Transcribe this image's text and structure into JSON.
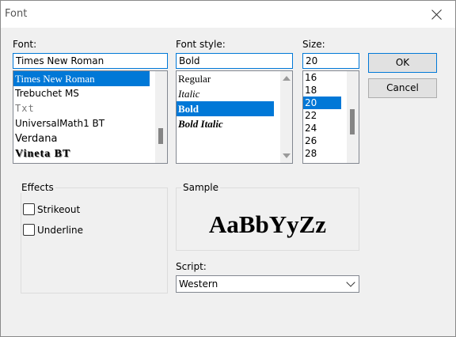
{
  "window": {
    "title": "Font"
  },
  "font": {
    "label": "Font:",
    "value": "Times New Roman",
    "items": [
      "Times New Roman",
      "Trebuchet MS",
      "Txt",
      "UniversalMath1 BT",
      "Verdana",
      "Vineta BT"
    ]
  },
  "style": {
    "label": "Font style:",
    "value": "Bold",
    "items": [
      "Regular",
      "Italic",
      "Bold",
      "Bold Italic"
    ]
  },
  "size": {
    "label": "Size:",
    "value": "20",
    "items": [
      "16",
      "18",
      "20",
      "22",
      "24",
      "26",
      "28"
    ]
  },
  "buttons": {
    "ok": "OK",
    "cancel": "Cancel"
  },
  "effects": {
    "label": "Effects",
    "strikeout": "Strikeout",
    "underline": "Underline"
  },
  "sample": {
    "label": "Sample",
    "text": "AaBbYyZz"
  },
  "script": {
    "label": "Script:",
    "value": "Western"
  },
  "colors": {
    "selection": "#0078d7"
  }
}
